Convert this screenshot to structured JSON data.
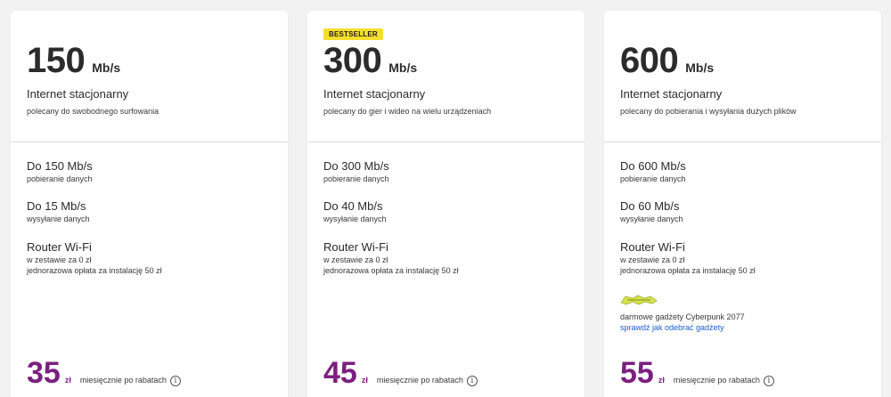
{
  "plans": [
    {
      "badge": "",
      "speed": "150",
      "unit": "Mb/s",
      "title": "Internet stacjonarny",
      "subtitle": "polecany do swobodnego surfowania",
      "download_title": "Do 150 Mb/s",
      "download_desc": "pobieranie danych",
      "upload_title": "Do 15 Mb/s",
      "upload_desc": "wysyłanie danych",
      "router_title": "Router Wi-Fi",
      "router_line1": "w zestawie za 0 zł",
      "router_line2": "jednorazowa opłata za instalację 50 zł",
      "price": "35",
      "currency": "zł",
      "price_label": "miesięcznie po rabatach"
    },
    {
      "badge": "BESTSELLER",
      "speed": "300",
      "unit": "Mb/s",
      "title": "Internet stacjonarny",
      "subtitle": "polecany do gier i wideo na wielu urządzeniach",
      "download_title": "Do 300 Mb/s",
      "download_desc": "pobieranie danych",
      "upload_title": "Do 40 Mb/s",
      "upload_desc": "wysyłanie danych",
      "router_title": "Router Wi-Fi",
      "router_line1": "w zestawie za 0 zł",
      "router_line2": "jednorazowa opłata za instalację 50 zł",
      "price": "45",
      "currency": "zł",
      "price_label": "miesięcznie po rabatach"
    },
    {
      "badge": "",
      "speed": "600",
      "unit": "Mb/s",
      "title": "Internet stacjonarny",
      "subtitle": "polecany do pobierania i wysyłania dużych plików",
      "download_title": "Do 600 Mb/s",
      "download_desc": "pobieranie danych",
      "upload_title": "Do 60 Mb/s",
      "upload_desc": "wysyłanie danych",
      "router_title": "Router Wi-Fi",
      "router_line1": "w zestawie za 0 zł",
      "router_line2": "jednorazowa opłata za instalację 50 zł",
      "promo_logo_icon": "cyberpunk-logo",
      "promo_text": "darmowe gadżety Cyberpunk 2077",
      "promo_link": "sprawdź jak odebrać gadżety",
      "price": "55",
      "currency": "zł",
      "price_label": "miesięcznie po rabatach"
    }
  ],
  "info_icon_glyph": "i",
  "colors": {
    "price": "#7b1f7e",
    "badge": "#f6df2b",
    "link": "#1a5fd0",
    "promo_logo": "#d9e44a"
  }
}
